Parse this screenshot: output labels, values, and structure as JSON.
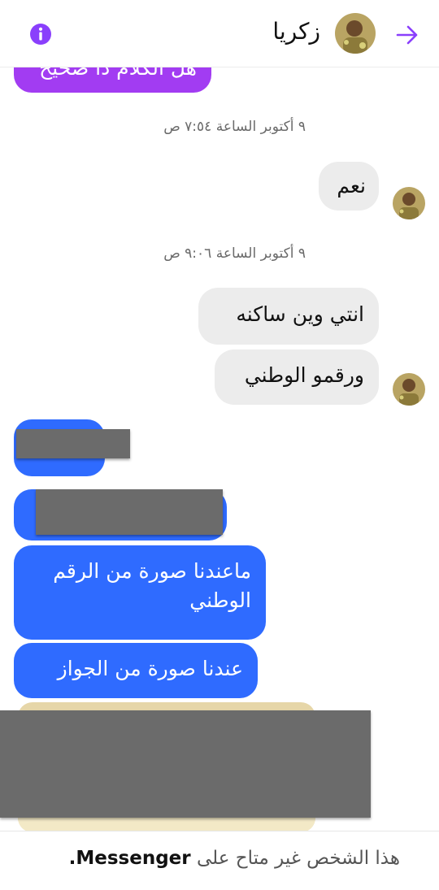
{
  "header": {
    "contact_name": "زكريا",
    "accent_color": "#8a3ffc",
    "icons": [
      "info-icon",
      "back-arrow-icon",
      "avatar"
    ]
  },
  "messages": {
    "partial_top": "هل الكلام دا صحيح",
    "ts1": "٩ أكتوبر الساعة ٧:٥٤ ص",
    "m_naam": "نعم",
    "ts2": "٩ أكتوبر الساعة ٩:٠٦ ص",
    "m_where": "انتي وين ساكنه",
    "m_number": "ورقمو الوطني",
    "m_no_photo": "ماعندنا صورة من الرقم الوطني",
    "m_passport": "عندنا صورة من الجواز"
  },
  "colors": {
    "outgoing_bubble": "#2f6bff",
    "incoming_bubble": "#ececec",
    "purple_bubble": "#a23cf2",
    "redaction": "#6b6b6b"
  },
  "footer": {
    "text_prefix": "هذا الشخص غير متاح على",
    "brand": "Messenger",
    "suffix": "."
  }
}
